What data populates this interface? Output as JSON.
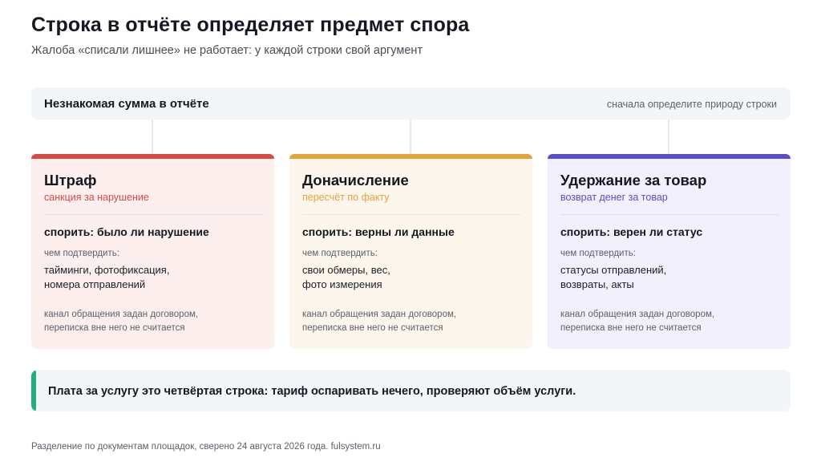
{
  "header": {
    "title": "Строка в отчёте определяет предмет спора",
    "subtitle": "Жалоба «списали лишнее» не работает: у каждой строки свой аргумент"
  },
  "top_bar": {
    "title": "Незнакомая сумма в отчёте",
    "hint": "сначала определите природу строки"
  },
  "cards": [
    {
      "title": "Штраф",
      "subtitle": "санкция за нарушение",
      "dispute": "спорить: было ли нарушение",
      "proof_label": "чем подтвердить:",
      "proof_lines": [
        "тайминги, фотофиксация,",
        "номера отправлений"
      ],
      "note_lines": [
        "канал обращения задан договором,",
        "переписка вне него не считается"
      ],
      "accent": "#d64a45",
      "background": "#fcefee",
      "subtitle_color": "#d64a45"
    },
    {
      "title": "Доначисление",
      "subtitle": "пересчёт по факту",
      "dispute": "спорить: верны ли данные",
      "proof_label": "чем подтвердить:",
      "proof_lines": [
        "свои обмеры, вес,",
        "фото измерения"
      ],
      "note_lines": [
        "канал обращения задан договором,",
        "переписка вне него не считается"
      ],
      "accent": "#e5a13a",
      "background": "#fdf6ec",
      "subtitle_color": "#e5a13a"
    },
    {
      "title": "Удержание за товар",
      "subtitle": "возврат денег за товар",
      "dispute": "спорить: верен ли статус",
      "proof_label": "чем подтвердить:",
      "proof_lines": [
        "статусы отправлений,",
        "возвраты, акты"
      ],
      "note_lines": [
        "канал обращения задан договором,",
        "переписка вне него не считается"
      ],
      "accent": "#5a4fc5",
      "background": "#f1f0fc",
      "subtitle_color": "#5a4fc5"
    }
  ],
  "bottom_bar": {
    "text": "Плата за услугу это четвёртая строка: тариф оспаривать нечего, проверяют объём услуги.",
    "accent": "#1fb07a"
  },
  "footer": {
    "text": "Разделение по документам площадок, сверено 24 августа 2026 года. fulsystem.ru"
  }
}
